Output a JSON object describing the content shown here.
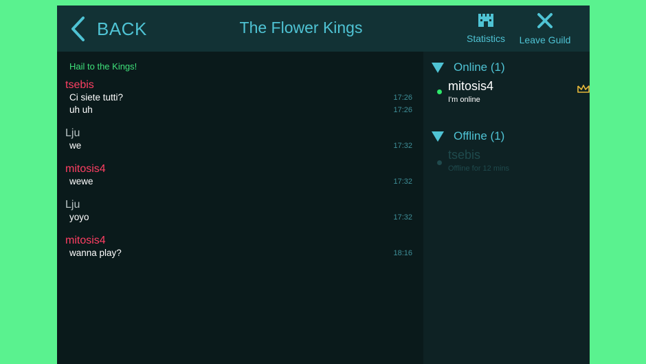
{
  "header": {
    "back_label": "BACK",
    "title": "The Flower Kings",
    "statistics_label": "Statistics",
    "leave_label": "Leave Guild"
  },
  "chat": {
    "motd": "Hail to the Kings!",
    "groups": [
      {
        "author": "tsebis",
        "color": "red",
        "lines": [
          {
            "text": "Ci siete tutti?",
            "time": "17:26"
          },
          {
            "text": "uh uh",
            "time": "17:26"
          }
        ]
      },
      {
        "author": "Lju",
        "color": "gray",
        "lines": [
          {
            "text": "we",
            "time": "17:32"
          }
        ]
      },
      {
        "author": "mitosis4",
        "color": "red",
        "lines": [
          {
            "text": "wewe",
            "time": "17:32"
          }
        ]
      },
      {
        "author": "Lju",
        "color": "gray",
        "lines": [
          {
            "text": "yoyo",
            "time": "17:32"
          }
        ]
      },
      {
        "author": "mitosis4",
        "color": "red",
        "lines": [
          {
            "text": "wanna play?",
            "time": "18:16"
          }
        ]
      }
    ]
  },
  "sidebar": {
    "online_label": "Online (1)",
    "offline_label": "Offline (1)",
    "online_members": [
      {
        "name": "mitosis4",
        "status": "I'm online"
      }
    ],
    "offline_members": [
      {
        "name": "tsebis",
        "status": "Offline for 12 mins"
      }
    ]
  },
  "colors": {
    "page_bg": "#5af28f",
    "accent": "#4fc3d4",
    "author_red": "#ff3f63",
    "online_green": "#2ee86a",
    "crown": "#e8b93a"
  },
  "icons": {
    "back": "chevron-left-icon",
    "statistics": "castle-icon",
    "leave": "close-icon",
    "leader": "crown-icon"
  }
}
